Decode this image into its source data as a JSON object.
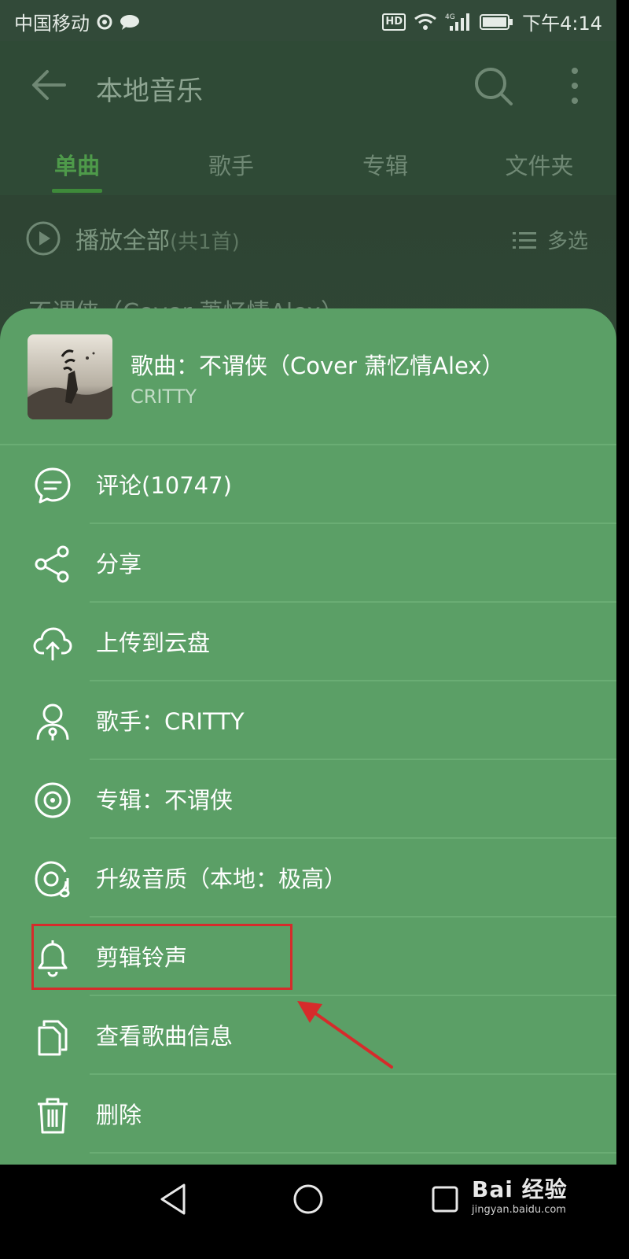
{
  "status_bar": {
    "carrier": "中国移动",
    "time": "下午4:14",
    "hd": "HD",
    "net": "4G"
  },
  "header": {
    "title": "本地音乐"
  },
  "tabs": [
    {
      "label": "单曲"
    },
    {
      "label": "歌手"
    },
    {
      "label": "专辑"
    },
    {
      "label": "文件夹"
    }
  ],
  "list": {
    "play_all": "播放全部",
    "count": "(共1首)",
    "multi_select": "多选",
    "behind_song": "不谓侠（Cover 萧忆情Alex）"
  },
  "sheet": {
    "song_title": "歌曲：不谓侠（Cover 萧忆情Alex）",
    "artist": "CRITTY",
    "items": [
      {
        "label": "评论(10747)",
        "icon": "comment-icon"
      },
      {
        "label": "分享",
        "icon": "share-icon"
      },
      {
        "label": "上传到云盘",
        "icon": "cloud-upload-icon"
      },
      {
        "label": "歌手：CRITTY",
        "icon": "singer-icon"
      },
      {
        "label": "专辑：不谓侠",
        "icon": "album-icon"
      },
      {
        "label": "升级音质（本地：极高）",
        "icon": "quality-icon"
      },
      {
        "label": "剪辑铃声",
        "icon": "bell-icon"
      },
      {
        "label": "查看歌曲信息",
        "icon": "info-docs-icon"
      },
      {
        "label": "删除",
        "icon": "trash-icon"
      }
    ]
  },
  "watermark": {
    "brand": "Bai 经验",
    "url": "jingyan.baidu.com"
  },
  "colors": {
    "sheet_bg": "#5b9f66",
    "accent": "#3e8a3a",
    "highlight": "#d62b2b"
  }
}
